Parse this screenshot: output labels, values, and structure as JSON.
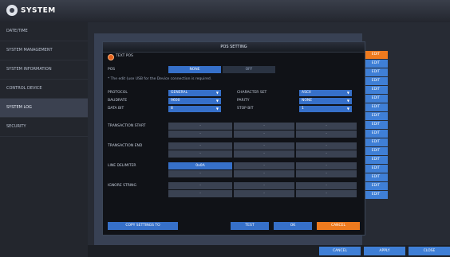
{
  "app": {
    "title": "SYSTEM"
  },
  "sidebar": {
    "items": [
      {
        "label": "DATE/TIME"
      },
      {
        "label": "SYSTEM MANAGEMENT"
      },
      {
        "label": "SYSTEM INFORMATION"
      },
      {
        "label": "CONTROL DEVICE"
      },
      {
        "label": "SYSTEM LOG"
      },
      {
        "label": "SECURITY"
      }
    ]
  },
  "edit_buttons": {
    "label": "EDIT"
  },
  "dialog": {
    "title": "POS SETTING",
    "text_pos_label": "TEXT POS",
    "pos_label": "POS",
    "pos_options": [
      "NONE",
      "OFF"
    ],
    "hint": "* The edit (use USB for the Device connection is required.",
    "fields": {
      "protocol": {
        "label": "PROTOCOL",
        "value": "GENERAL"
      },
      "baudrate": {
        "label": "BAUDRATE",
        "value": "9600"
      },
      "data_bit": {
        "label": "DATA BIT",
        "value": "8"
      },
      "character_set": {
        "label": "CHARACTER SET",
        "value": "ASCII"
      },
      "parity": {
        "label": "PARITY",
        "value": "NONE"
      },
      "stop_bit": {
        "label": "STOP BIT",
        "value": "1"
      }
    },
    "grid_labels": {
      "trans_start": "TRANSACTION START",
      "trans_end": "TRANSACTION END",
      "line_delimiter": "LINE DELIMITER",
      "ignore_string": "IGNORE STRING"
    },
    "grid_placeholder": "-",
    "line_delimiter_value": "0x0A",
    "buttons": {
      "copy": "COPY SETTINGS TO",
      "test": "TEST",
      "ok": "OK",
      "cancel": "CANCEL"
    }
  },
  "footer": {
    "cancel": "CANCEL",
    "apply": "APPLY",
    "close": "CLOSE"
  }
}
